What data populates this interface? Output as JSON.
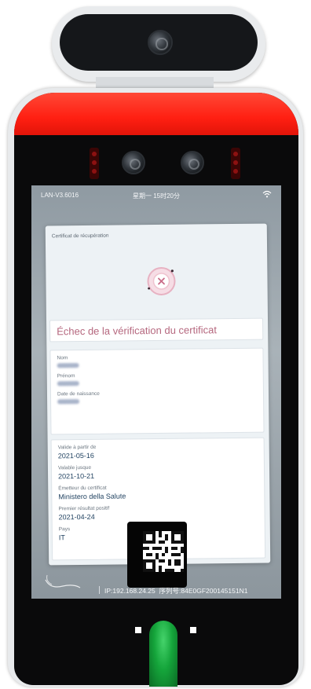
{
  "status_bar": {
    "version": "LAN-V3.6016",
    "datetime": "星期一 15时20分",
    "wifi_icon": "wifi-icon"
  },
  "card": {
    "header": "Certificat de récupération",
    "status_icon": "error-x-icon",
    "result_title": "Échec de la vérification du certificat",
    "personal_fields": [
      {
        "label": "Nom"
      },
      {
        "label": "Prénom"
      },
      {
        "label": "Date de naissance"
      }
    ],
    "certificate_fields": [
      {
        "label": "Valide à partir de",
        "value": "2021-05-16"
      },
      {
        "label": "Valable jusque",
        "value": "2021-10-21"
      },
      {
        "label": "Émetteur du certificat",
        "value": "Ministero della Salute"
      },
      {
        "label": "Premier résultat positif",
        "value": "2021-04-24"
      },
      {
        "label": "Pays",
        "value": "IT"
      }
    ]
  },
  "footer": {
    "ip": "IP:192.168.24.25",
    "serial": "序列号:84E0GF200145151N1"
  },
  "colors": {
    "accent_red": "#ff2a1a",
    "title_rose": "#b5677e",
    "value_navy": "#1d3f5e",
    "led_green": "#1fb84a"
  }
}
